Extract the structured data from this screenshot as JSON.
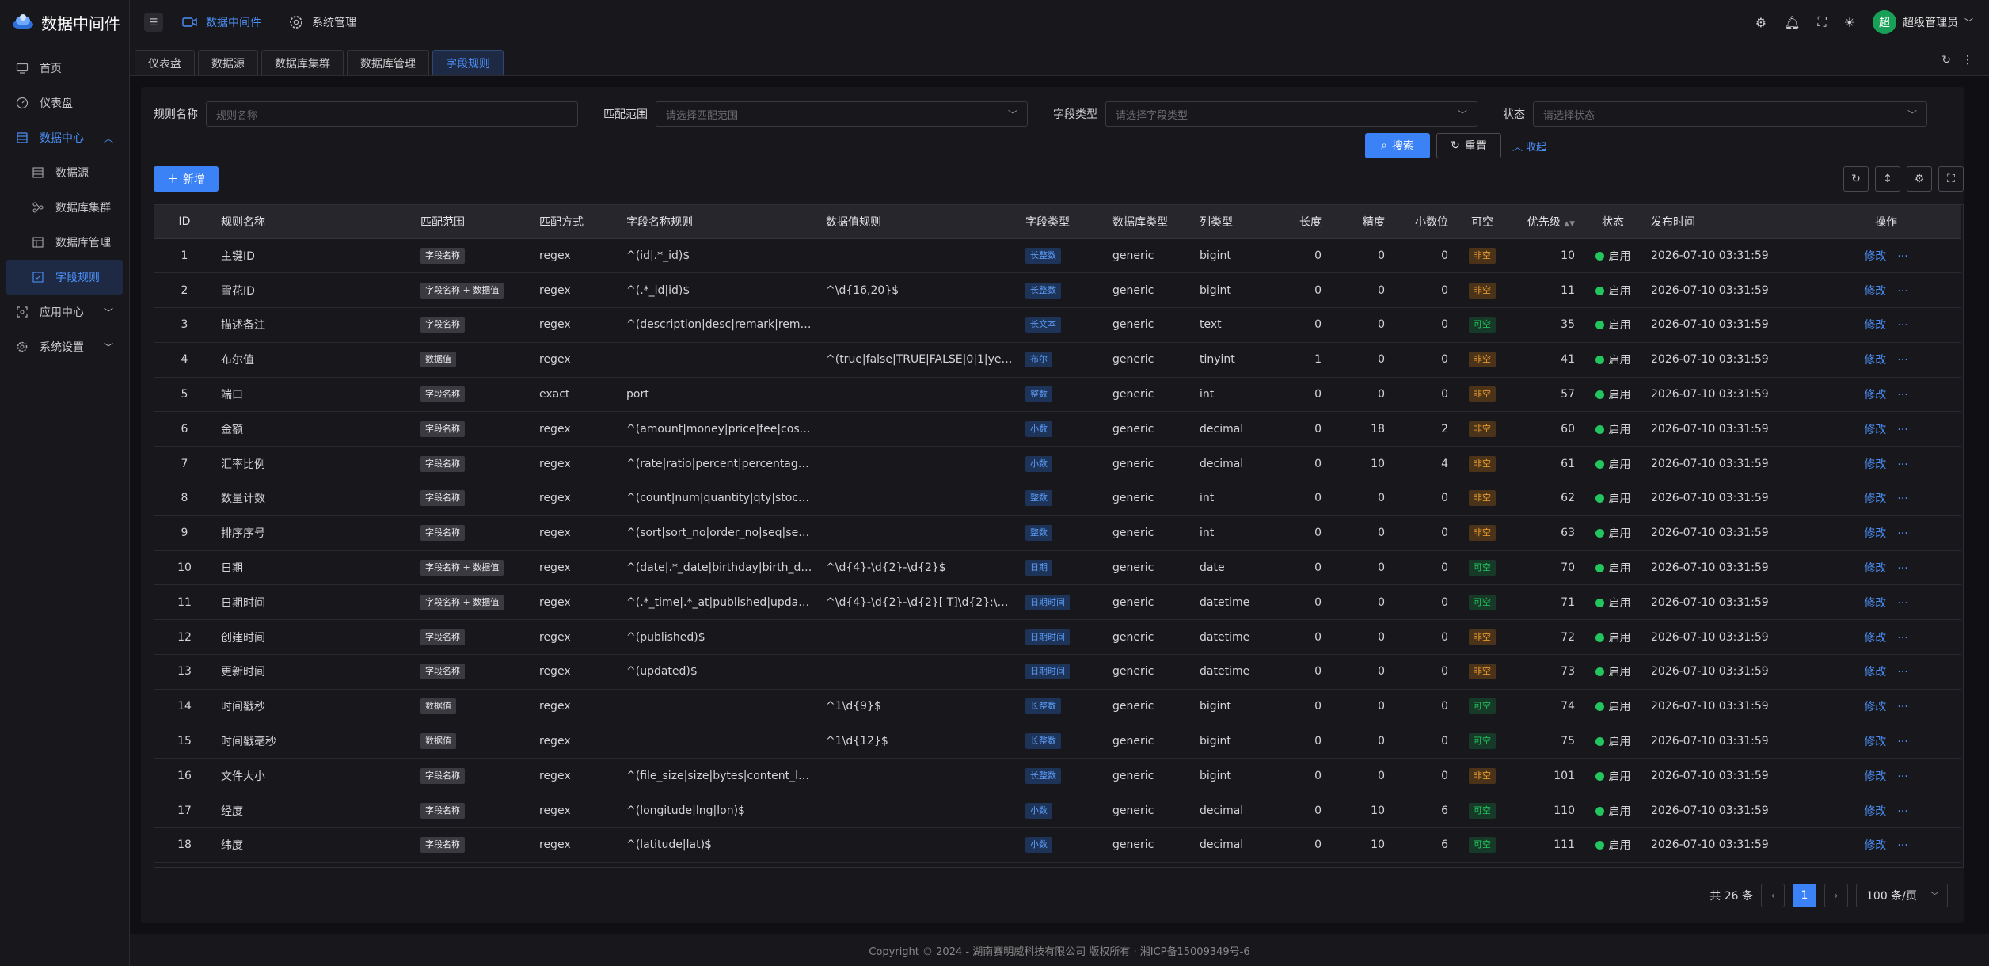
{
  "app": {
    "title": "数据中间件"
  },
  "sidebar": {
    "items": [
      {
        "label": "首页"
      },
      {
        "label": "仪表盘"
      },
      {
        "label": "数据中心"
      },
      {
        "label": "数据源"
      },
      {
        "label": "数据库集群"
      },
      {
        "label": "数据库管理"
      },
      {
        "label": "字段规则"
      },
      {
        "label": "应用中心"
      },
      {
        "label": "系统设置"
      }
    ]
  },
  "topbar": {
    "nav": [
      {
        "label": "数据中间件"
      },
      {
        "label": "系统管理"
      }
    ],
    "user": {
      "avatar_text": "超",
      "name": "超级管理员"
    }
  },
  "tabs": [
    {
      "label": "仪表盘"
    },
    {
      "label": "数据源"
    },
    {
      "label": "数据库集群"
    },
    {
      "label": "数据库管理"
    },
    {
      "label": "字段规则"
    }
  ],
  "filters": {
    "rule_name": {
      "label": "规则名称",
      "placeholder": "规则名称"
    },
    "match_scope": {
      "label": "匹配范围",
      "placeholder": "请选择匹配范围"
    },
    "field_type": {
      "label": "字段类型",
      "placeholder": "请选择字段类型"
    },
    "status": {
      "label": "状态",
      "placeholder": "请选择状态"
    },
    "search_label": "搜索",
    "reset_label": "重置",
    "collapse_label": "收起"
  },
  "toolbar": {
    "add_label": "新增"
  },
  "table": {
    "columns": [
      "ID",
      "规则名称",
      "匹配范围",
      "匹配方式",
      "字段名称规则",
      "数据值规则",
      "字段类型",
      "数据库类型",
      "列类型",
      "长度",
      "精度",
      "小数位",
      "可空",
      "优先级",
      "状态",
      "发布时间",
      "操作"
    ],
    "edit_label": "修改",
    "more_label": "···",
    "rows": [
      {
        "id": "1",
        "name": "主键ID",
        "scope": "字段名称",
        "method": "regex",
        "name_rule": "^(id|.*_id)$",
        "value_rule": "",
        "ftype": "长整数",
        "ftype_color": "blue",
        "db": "generic",
        "col": "bigint",
        "len": "0",
        "prec": "0",
        "scale": "0",
        "nullable": "非空",
        "priority": "10",
        "status": "启用",
        "time": "2026-07-10 03:31:59"
      },
      {
        "id": "2",
        "name": "雪花ID",
        "scope": "字段名称 + 数据值",
        "method": "regex",
        "name_rule": "^(.*_id|id)$",
        "value_rule": "^\\d{16,20}$",
        "ftype": "长整数",
        "ftype_color": "blue",
        "db": "generic",
        "col": "bigint",
        "len": "0",
        "prec": "0",
        "scale": "0",
        "nullable": "非空",
        "priority": "11",
        "status": "启用",
        "time": "2026-07-10 03:31:59"
      },
      {
        "id": "3",
        "name": "描述备注",
        "scope": "字段名称",
        "method": "regex",
        "name_rule": "^(description|desc|remark|rema...",
        "value_rule": "",
        "ftype": "长文本",
        "ftype_color": "blue",
        "db": "generic",
        "col": "text",
        "len": "0",
        "prec": "0",
        "scale": "0",
        "nullable": "可空",
        "priority": "35",
        "status": "启用",
        "time": "2026-07-10 03:31:59"
      },
      {
        "id": "4",
        "name": "布尔值",
        "scope": "数据值",
        "method": "regex",
        "name_rule": "",
        "value_rule": "^(true|false|TRUE|FALSE|0|1|yes...",
        "ftype": "布尔",
        "ftype_color": "blue",
        "db": "generic",
        "col": "tinyint",
        "len": "1",
        "prec": "0",
        "scale": "0",
        "nullable": "非空",
        "priority": "41",
        "status": "启用",
        "time": "2026-07-10 03:31:59"
      },
      {
        "id": "5",
        "name": "端口",
        "scope": "字段名称",
        "method": "exact",
        "name_rule": "port",
        "value_rule": "",
        "ftype": "整数",
        "ftype_color": "blue",
        "db": "generic",
        "col": "int",
        "len": "0",
        "prec": "0",
        "scale": "0",
        "nullable": "非空",
        "priority": "57",
        "status": "启用",
        "time": "2026-07-10 03:31:59"
      },
      {
        "id": "6",
        "name": "金额",
        "scope": "字段名称",
        "method": "regex",
        "name_rule": "^(amount|money|price|fee|cost|...",
        "value_rule": "",
        "ftype": "小数",
        "ftype_color": "blue",
        "db": "generic",
        "col": "decimal",
        "len": "0",
        "prec": "18",
        "scale": "2",
        "nullable": "非空",
        "priority": "60",
        "status": "启用",
        "time": "2026-07-10 03:31:59"
      },
      {
        "id": "7",
        "name": "汇率比例",
        "scope": "字段名称",
        "method": "regex",
        "name_rule": "^(rate|ratio|percent|percentage|...",
        "value_rule": "",
        "ftype": "小数",
        "ftype_color": "blue",
        "db": "generic",
        "col": "decimal",
        "len": "0",
        "prec": "10",
        "scale": "4",
        "nullable": "非空",
        "priority": "61",
        "status": "启用",
        "time": "2026-07-10 03:31:59"
      },
      {
        "id": "8",
        "name": "数量计数",
        "scope": "字段名称",
        "method": "regex",
        "name_rule": "^(count|num|quantity|qty|stock|i...",
        "value_rule": "",
        "ftype": "整数",
        "ftype_color": "blue",
        "db": "generic",
        "col": "int",
        "len": "0",
        "prec": "0",
        "scale": "0",
        "nullable": "非空",
        "priority": "62",
        "status": "启用",
        "time": "2026-07-10 03:31:59"
      },
      {
        "id": "9",
        "name": "排序序号",
        "scope": "字段名称",
        "method": "regex",
        "name_rule": "^(sort|sort_no|order_no|seq|seq...",
        "value_rule": "",
        "ftype": "整数",
        "ftype_color": "blue",
        "db": "generic",
        "col": "int",
        "len": "0",
        "prec": "0",
        "scale": "0",
        "nullable": "非空",
        "priority": "63",
        "status": "启用",
        "time": "2026-07-10 03:31:59"
      },
      {
        "id": "10",
        "name": "日期",
        "scope": "字段名称 + 数据值",
        "method": "regex",
        "name_rule": "^(date|.*_date|birthday|birth_dat...",
        "value_rule": "^\\d{4}-\\d{2}-\\d{2}$",
        "ftype": "日期",
        "ftype_color": "blue",
        "db": "generic",
        "col": "date",
        "len": "0",
        "prec": "0",
        "scale": "0",
        "nullable": "可空",
        "priority": "70",
        "status": "启用",
        "time": "2026-07-10 03:31:59"
      },
      {
        "id": "11",
        "name": "日期时间",
        "scope": "字段名称 + 数据值",
        "method": "regex",
        "name_rule": "^(.*_time|.*_at|published|update...",
        "value_rule": "^\\d{4}-\\d{2}-\\d{2}[ T]\\d{2}:\\d{2}...",
        "ftype": "日期时间",
        "ftype_color": "blue",
        "db": "generic",
        "col": "datetime",
        "len": "0",
        "prec": "0",
        "scale": "0",
        "nullable": "可空",
        "priority": "71",
        "status": "启用",
        "time": "2026-07-10 03:31:59"
      },
      {
        "id": "12",
        "name": "创建时间",
        "scope": "字段名称",
        "method": "regex",
        "name_rule": "^(published)$",
        "value_rule": "",
        "ftype": "日期时间",
        "ftype_color": "blue",
        "db": "generic",
        "col": "datetime",
        "len": "0",
        "prec": "0",
        "scale": "0",
        "nullable": "非空",
        "priority": "72",
        "status": "启用",
        "time": "2026-07-10 03:31:59"
      },
      {
        "id": "13",
        "name": "更新时间",
        "scope": "字段名称",
        "method": "regex",
        "name_rule": "^(updated)$",
        "value_rule": "",
        "ftype": "日期时间",
        "ftype_color": "blue",
        "db": "generic",
        "col": "datetime",
        "len": "0",
        "prec": "0",
        "scale": "0",
        "nullable": "非空",
        "priority": "73",
        "status": "启用",
        "time": "2026-07-10 03:31:59"
      },
      {
        "id": "14",
        "name": "时间戳秒",
        "scope": "数据值",
        "method": "regex",
        "name_rule": "",
        "value_rule": "^1\\d{9}$",
        "ftype": "长整数",
        "ftype_color": "blue",
        "db": "generic",
        "col": "bigint",
        "len": "0",
        "prec": "0",
        "scale": "0",
        "nullable": "可空",
        "priority": "74",
        "status": "启用",
        "time": "2026-07-10 03:31:59"
      },
      {
        "id": "15",
        "name": "时间戳毫秒",
        "scope": "数据值",
        "method": "regex",
        "name_rule": "",
        "value_rule": "^1\\d{12}$",
        "ftype": "长整数",
        "ftype_color": "blue",
        "db": "generic",
        "col": "bigint",
        "len": "0",
        "prec": "0",
        "scale": "0",
        "nullable": "可空",
        "priority": "75",
        "status": "启用",
        "time": "2026-07-10 03:31:59"
      },
      {
        "id": "16",
        "name": "文件大小",
        "scope": "字段名称",
        "method": "regex",
        "name_rule": "^(file_size|size|bytes|content_le...",
        "value_rule": "",
        "ftype": "长整数",
        "ftype_color": "blue",
        "db": "generic",
        "col": "bigint",
        "len": "0",
        "prec": "0",
        "scale": "0",
        "nullable": "非空",
        "priority": "101",
        "status": "启用",
        "time": "2026-07-10 03:31:59"
      },
      {
        "id": "17",
        "name": "经度",
        "scope": "字段名称",
        "method": "regex",
        "name_rule": "^(longitude|lng|lon)$",
        "value_rule": "",
        "ftype": "小数",
        "ftype_color": "blue",
        "db": "generic",
        "col": "decimal",
        "len": "0",
        "prec": "10",
        "scale": "6",
        "nullable": "可空",
        "priority": "110",
        "status": "启用",
        "time": "2026-07-10 03:31:59"
      },
      {
        "id": "18",
        "name": "纬度",
        "scope": "字段名称",
        "method": "regex",
        "name_rule": "^(latitude|lat)$",
        "value_rule": "",
        "ftype": "小数",
        "ftype_color": "blue",
        "db": "generic",
        "col": "decimal",
        "len": "0",
        "prec": "10",
        "scale": "6",
        "nullable": "可空",
        "priority": "111",
        "status": "启用",
        "time": "2026-07-10 03:31:59"
      }
    ]
  },
  "pagination": {
    "total_label": "共 26 条",
    "current_page": "1",
    "page_size_label": "100 条/页"
  },
  "footer": {
    "text": "Copyright © 2024 - 湖南赛明威科技有限公司 版权所有 · 湘ICP备15009349号-6"
  }
}
